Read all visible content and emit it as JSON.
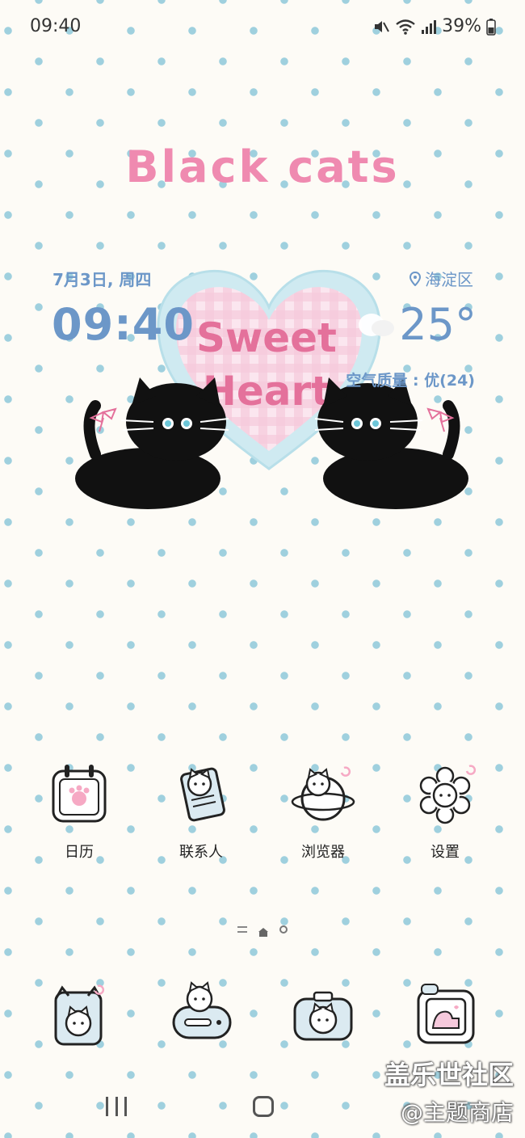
{
  "status_bar": {
    "time": "09:40",
    "battery": "39%"
  },
  "wallpaper": {
    "headline": "Black cats",
    "heart_line1": "Sweet",
    "heart_line2": "Heart"
  },
  "widget": {
    "date": "7月3日, 周四",
    "location": "海淀区",
    "time": "09:40",
    "temperature": "25°",
    "air_quality": "空气质量 : 优(24)"
  },
  "apps": [
    {
      "label": "日历",
      "icon": "calendar-icon"
    },
    {
      "label": "联系人",
      "icon": "contacts-icon"
    },
    {
      "label": "浏览器",
      "icon": "browser-icon"
    },
    {
      "label": "设置",
      "icon": "settings-icon"
    }
  ],
  "dock": [
    {
      "icon": "phone-icon"
    },
    {
      "icon": "messages-icon"
    },
    {
      "icon": "camera-icon"
    },
    {
      "icon": "gallery-icon"
    }
  ],
  "watermark": {
    "line1": "盖乐世社区",
    "line2": "@主题商店"
  },
  "colors": {
    "accent_blue": "#6c97c8",
    "pink": "#ef8ab0",
    "dot": "#9fd0de"
  }
}
